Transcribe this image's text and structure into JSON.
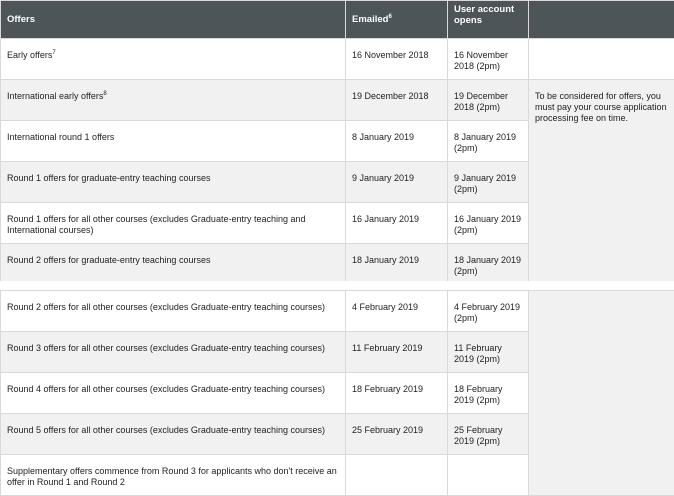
{
  "table1": {
    "headers": {
      "offers": "Offers",
      "emailed": "Emailed",
      "emailed_note": "6",
      "user_account": "User account opens"
    },
    "rows": [
      {
        "offer": "Early offers",
        "offer_note": "7",
        "emailed": "16 November 2018",
        "opens": "16 November 2018 (2pm)"
      },
      {
        "offer": "International early offers",
        "offer_note": "8",
        "emailed": "19 December 2018",
        "opens": "19 December 2018 (2pm)"
      },
      {
        "offer": "International round 1 offers",
        "offer_note": "",
        "emailed": "8 January 2019",
        "opens": "8 January 2019 (2pm)"
      },
      {
        "offer": "Round 1 offers for graduate-entry teaching courses",
        "offer_note": "",
        "emailed": "9 January 2019",
        "opens": "9 January 2019 (2pm)"
      },
      {
        "offer": "Round 1 offers for all other courses (excludes Graduate-entry teaching and International courses)",
        "offer_note": "",
        "emailed": "16 January 2019",
        "opens": "16 January 2019 (2pm)"
      },
      {
        "offer": "Round 2 offers for graduate-entry teaching courses",
        "offer_note": "",
        "emailed": "18 January 2019",
        "opens": "18 January 2019 (2pm)"
      }
    ],
    "note": "To be considered for offers, you must pay your course application processing fee on time."
  },
  "table2": {
    "rows": [
      {
        "offer": "Round 2 offers for all other courses (excludes Graduate-entry teaching courses)",
        "emailed": "4 February 2019",
        "opens": "4 February 2019 (2pm)"
      },
      {
        "offer": "Round 3 offers for all other courses (excludes Graduate-entry teaching courses)",
        "emailed": "11 February 2019",
        "opens": "11 February 2019 (2pm)"
      },
      {
        "offer": "Round 4 offers for all other courses (excludes Graduate-entry teaching courses)",
        "emailed": "18 February 2019",
        "opens": "18 February 2019 (2pm)"
      },
      {
        "offer": "Round 5 offers for all other courses (excludes Graduate-entry teaching courses)",
        "emailed": "25 February 2019",
        "opens": "25 February 2019 (2pm)"
      },
      {
        "offer": "Supplementary offers commence from Round 3 for applicants who don't receive an offer in Round 1 and Round 2",
        "emailed": "",
        "opens": ""
      }
    ]
  }
}
